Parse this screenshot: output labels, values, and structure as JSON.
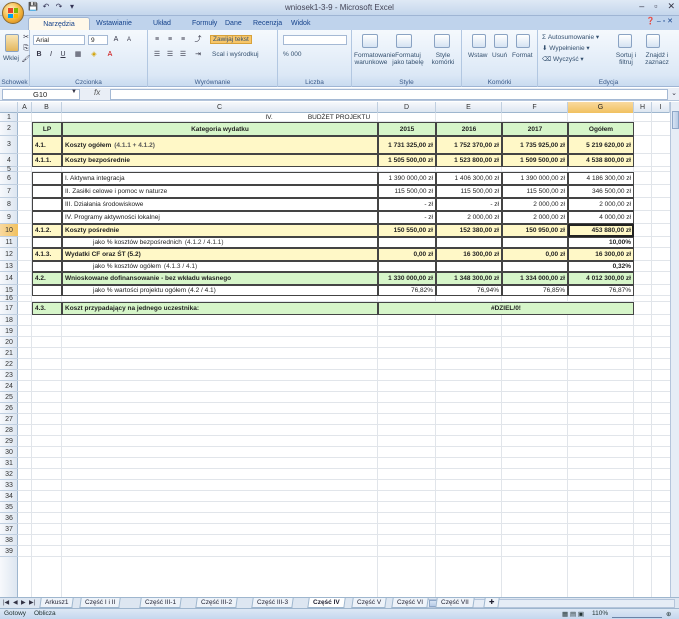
{
  "window": {
    "title": "wniosek1-3-9 - Microsoft Excel",
    "controls": [
      "–",
      "▫",
      "✕"
    ]
  },
  "ribbon_tabs": [
    "Narzędzia główne",
    "Wstawianie",
    "Układ strony",
    "Formuły",
    "Dane",
    "Recenzja",
    "Widok"
  ],
  "ribbon": {
    "clipboard": {
      "paste": "Wklej",
      "label": "Schowek"
    },
    "font": {
      "name": "Arial",
      "size": "9",
      "label": "Czcionka"
    },
    "alignment": {
      "wrap": "Zawijaj tekst",
      "merge": "Scal i wyśrodkuj",
      "label": "Wyrównanie"
    },
    "number": {
      "label": "Liczba",
      "formats": "% 000"
    },
    "styles": {
      "conditional": "Formatowanie warunkowe",
      "table": "Formatuj jako tabelę",
      "cell": "Style komórki",
      "label": "Style"
    },
    "cells": {
      "insert": "Wstaw",
      "delete": "Usuń",
      "format": "Format",
      "label": "Komórki"
    },
    "editing": {
      "autosum": "Autosumowanie",
      "fill": "Wypełnienie",
      "clear": "Wyczyść",
      "sort": "Sortuj i filtruj",
      "find": "Znajdź i zaznacz",
      "label": "Edycja"
    }
  },
  "formula_bar": {
    "name_box": "G10",
    "fx": "fx",
    "value": ""
  },
  "columns": [
    "A",
    "B",
    "C",
    "D",
    "E",
    "F",
    "G",
    "H",
    "I"
  ],
  "rows": [
    "1",
    "2",
    "3",
    "4",
    "5",
    "6",
    "7",
    "8",
    "9",
    "10",
    "11",
    "12",
    "13",
    "14",
    "15",
    "16",
    "17",
    "18",
    "19",
    "20",
    "21",
    "22",
    "23",
    "24",
    "25",
    "26",
    "27",
    "28",
    "29",
    "30",
    "31",
    "32",
    "33",
    "34",
    "35",
    "36",
    "37",
    "38",
    "39"
  ],
  "sheet": {
    "title_num": "IV.",
    "title": "BUDŻET PROJEKTU",
    "headers": {
      "lp": "LP",
      "category": "Kategoria wydatku",
      "y2015": "2015",
      "y2016": "2016",
      "y2017": "2017",
      "total": "Ogółem"
    },
    "rows": [
      {
        "lp": "4.1.",
        "label": "Koszty ogółem",
        "note": "(4.1.1 + 4.1.2)",
        "v2015": "1 731 325,00 zł",
        "v2016": "1 752 370,00 zł",
        "v2017": "1 735 925,00 zł",
        "total": "5 219 620,00 zł"
      },
      {
        "lp": "4.1.1.",
        "label": "Koszty bezpośrednie",
        "v2015": "1 505 500,00 zł",
        "v2016": "1 523 800,00 zł",
        "v2017": "1 509 500,00 zł",
        "total": "4 538 800,00 zł"
      },
      {
        "label": "I. Aktywna integracja",
        "v2015": "1 390 000,00 zł",
        "v2016": "1 406 300,00 zł",
        "v2017": "1 390 000,00 zł",
        "total": "4 186 300,00 zł"
      },
      {
        "label": "II. Zasiłki celowe i pomoc w naturze",
        "v2015": "115 500,00 zł",
        "v2016": "115 500,00 zł",
        "v2017": "115 500,00 zł",
        "total": "346 500,00 zł"
      },
      {
        "label": "III. Działania środowiskowe",
        "v2015": "-   zł",
        "v2016": "-   zł",
        "v2017": "2 000,00 zł",
        "total": "2 000,00 zł"
      },
      {
        "label": "IV. Programy aktywności lokalnej",
        "v2015": "-   zł",
        "v2016": "2 000,00 zł",
        "v2017": "2 000,00 zł",
        "total": "4 000,00 zł"
      },
      {
        "lp": "4.1.2.",
        "label": "Koszty pośrednie",
        "v2015": "150 550,00 zł",
        "v2016": "152 380,00 zł",
        "v2017": "150 950,00 zł",
        "total": "453 880,00 zł"
      },
      {
        "label": "jako % kosztów bezpośrednich",
        "note": "(4.1.2 / 4.1.1)",
        "total": "10,00%"
      },
      {
        "lp": "4.1.3.",
        "label": "Wydatki CF oraz ŚT (5.2)",
        "v2015": "0,00 zł",
        "v2016": "16 300,00 zł",
        "v2017": "0,00 zł",
        "total": "16 300,00 zł"
      },
      {
        "label": "jako % kosztów ogółem",
        "note": "(4.1.3 / 4.1)",
        "total": "0,32%"
      },
      {
        "lp": "4.2.",
        "label": "Wnioskowane dofinansowanie - bez wkładu własnego",
        "v2015": "1 330 000,00 zł",
        "v2016": "1 348 300,00 zł",
        "v2017": "1 334 000,00 zł",
        "total": "4 012 300,00 zł"
      },
      {
        "label": "jako % wartości projektu ogółem (4.2 / 4.1)",
        "v2015": "76,82%",
        "v2016": "76,94%",
        "v2017": "76,85%",
        "total": "76,87%"
      },
      {
        "lp": "4.3.",
        "label": "Koszt przypadający na jednego uczestnika:",
        "total": "#DZIEL/0!"
      }
    ]
  },
  "sheet_tabs": [
    "Arkusz1",
    "Część I i II",
    "Część III-1",
    "Część III-2",
    "Część III-3",
    "Część IV",
    "Część V",
    "Część VI",
    "Część VII"
  ],
  "active_sheet": "Część IV",
  "status": {
    "ready": "Gotowy",
    "calc": "Oblicza",
    "zoom": "110%"
  }
}
